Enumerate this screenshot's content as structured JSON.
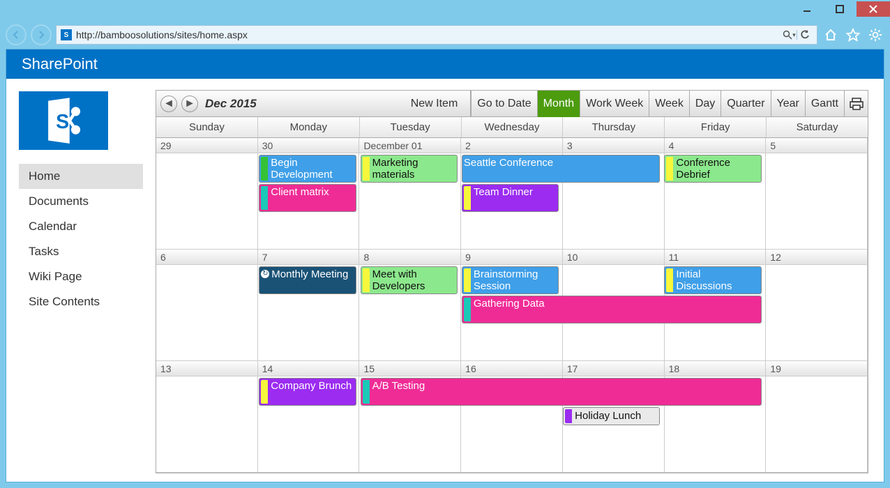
{
  "browser": {
    "url": "http://bamboosolutions/sites/home.aspx",
    "icon_label": "S"
  },
  "header": {
    "title": "SharePoint"
  },
  "sidebar": {
    "items": [
      {
        "label": "Home",
        "active": true
      },
      {
        "label": "Documents",
        "active": false
      },
      {
        "label": "Calendar",
        "active": false
      },
      {
        "label": "Tasks",
        "active": false
      },
      {
        "label": "Wiki Page",
        "active": false
      },
      {
        "label": "Site Contents",
        "active": false
      }
    ]
  },
  "calendar": {
    "title": "Dec 2015",
    "new_item_label": "New Item",
    "views": [
      {
        "label": "Go to Date",
        "active": false
      },
      {
        "label": "Month",
        "active": true
      },
      {
        "label": "Work Week",
        "active": false
      },
      {
        "label": "Week",
        "active": false
      },
      {
        "label": "Day",
        "active": false
      },
      {
        "label": "Quarter",
        "active": false
      },
      {
        "label": "Year",
        "active": false
      },
      {
        "label": "Gantt",
        "active": false
      }
    ],
    "day_names": [
      "Sunday",
      "Monday",
      "Tuesday",
      "Wednesday",
      "Thursday",
      "Friday",
      "Saturday"
    ],
    "weeks": [
      {
        "dates": [
          "29",
          "30",
          "December 01",
          "2",
          "3",
          "4",
          "5"
        ]
      },
      {
        "dates": [
          "6",
          "7",
          "8",
          "9",
          "10",
          "11",
          "12"
        ]
      },
      {
        "dates": [
          "13",
          "14",
          "15",
          "16",
          "17",
          "18",
          "19"
        ]
      }
    ],
    "events": {
      "w0": [
        {
          "label": "Begin Development",
          "col": 1,
          "span": 1,
          "row": 0,
          "bg": "bg-blue",
          "stripe": "st-green"
        },
        {
          "label": "Marketing materials",
          "col": 2,
          "span": 1,
          "row": 0,
          "bg": "bg-green",
          "stripe": "st-yellow"
        },
        {
          "label": "Seattle Conference",
          "col": 3,
          "span": 2,
          "row": 0,
          "bg": "bg-blue",
          "stripe": null
        },
        {
          "label": "Conference Debrief",
          "col": 5,
          "span": 1,
          "row": 0,
          "bg": "bg-green",
          "stripe": "st-yellow"
        },
        {
          "label": "Client matrix",
          "col": 1,
          "span": 1,
          "row": 1,
          "bg": "bg-pink",
          "stripe": "st-teal"
        },
        {
          "label": "Team Dinner",
          "col": 3,
          "span": 1,
          "row": 1,
          "bg": "bg-purple",
          "stripe": "st-yellow"
        }
      ],
      "w1": [
        {
          "label": "Monthly Meeting",
          "col": 1,
          "span": 1,
          "row": 0,
          "bg": "bg-navy",
          "stripe": null,
          "recur": true
        },
        {
          "label": "Meet with Developers",
          "col": 2,
          "span": 1,
          "row": 0,
          "bg": "bg-green",
          "stripe": "st-yellow"
        },
        {
          "label": "Brainstorming Session",
          "col": 3,
          "span": 1,
          "row": 0,
          "bg": "bg-blue",
          "stripe": "st-yellow"
        },
        {
          "label": "Initial Discussions",
          "col": 5,
          "span": 1,
          "row": 0,
          "bg": "bg-blue",
          "stripe": "st-yellow"
        },
        {
          "label": "Gathering Data",
          "col": 3,
          "span": 3,
          "row": 1,
          "bg": "bg-pink",
          "stripe": "st-teal"
        }
      ],
      "w2": [
        {
          "label": "Company Brunch",
          "col": 1,
          "span": 1,
          "row": 0,
          "bg": "bg-purple",
          "stripe": "st-yellow"
        },
        {
          "label": "A/B Testing",
          "col": 2,
          "span": 4,
          "row": 0,
          "bg": "bg-pink",
          "stripe": "st-teal"
        },
        {
          "label": "Holiday Lunch",
          "col": 4,
          "span": 1,
          "row": 1,
          "bg": "bg-grey",
          "stripe": "st-purple",
          "short": true
        }
      ]
    }
  }
}
